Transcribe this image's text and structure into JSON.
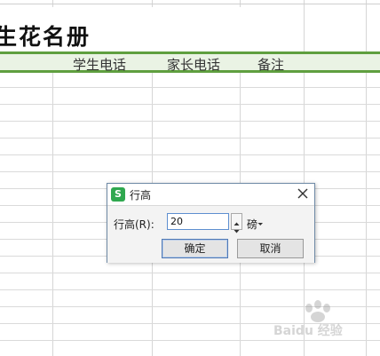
{
  "sheet": {
    "title": "生花名册",
    "headers": [
      "学生电话",
      "家长电话",
      "备注"
    ]
  },
  "dialog": {
    "title": "行高",
    "icon_letter": "S",
    "field_label": "行高(R):",
    "field_value": "20",
    "unit": "磅",
    "ok_label": "确定",
    "cancel_label": "取消",
    "close_icon": "close-icon"
  },
  "watermark": {
    "text": "Baidu 经验"
  },
  "colors": {
    "band": "#5f9f3f",
    "wps_green": "#2fa84f"
  }
}
